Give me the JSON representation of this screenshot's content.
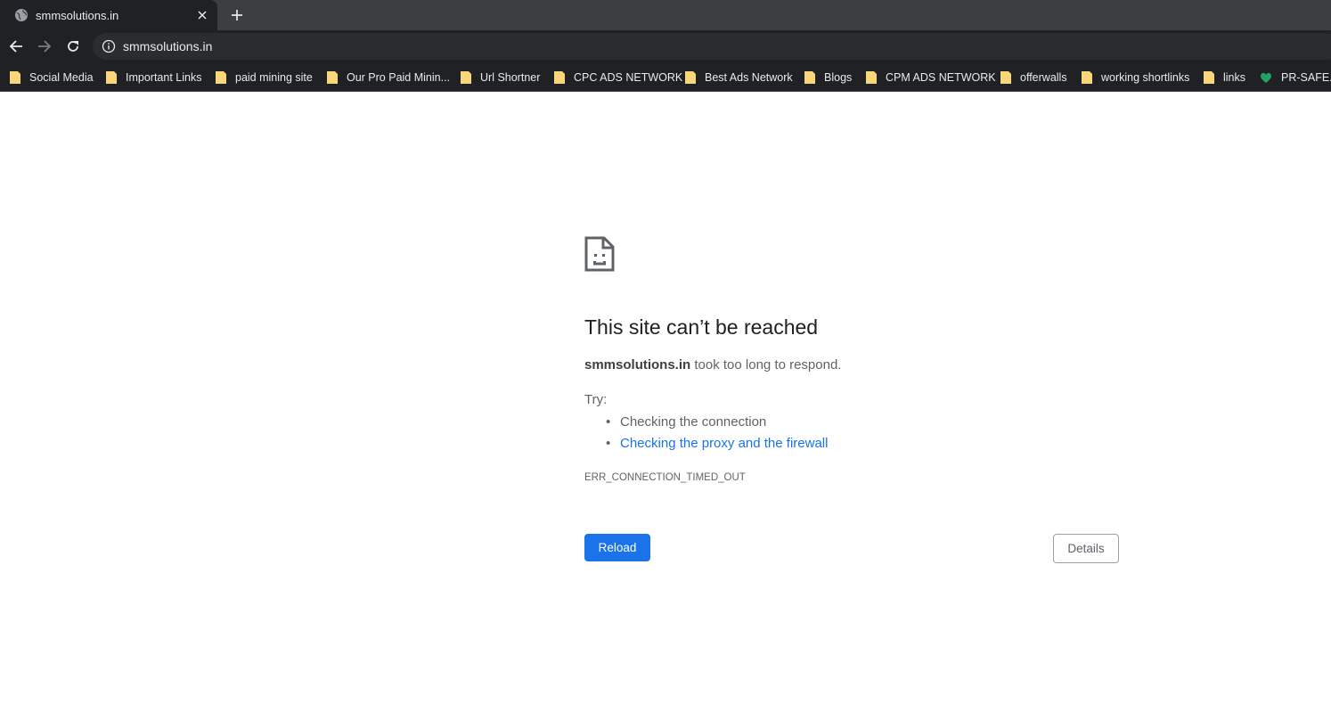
{
  "tab": {
    "title": "smmsolutions.in",
    "favicon": "globe-icon",
    "close_icon": "close-icon",
    "new_tab_icon": "plus-icon"
  },
  "toolbar": {
    "back_icon": "arrow-back-icon",
    "forward_icon": "arrow-forward-icon",
    "reload_icon": "reload-icon",
    "info_icon": "info-icon",
    "url": "smmsolutions.in"
  },
  "bookmarks": [
    {
      "label": "Social Media",
      "icon": "folder-icon"
    },
    {
      "label": "Important Links",
      "icon": "folder-icon"
    },
    {
      "label": "paid mining site",
      "icon": "folder-icon"
    },
    {
      "label": "Our Pro Paid Minin...",
      "icon": "folder-icon"
    },
    {
      "label": "Url Shortner",
      "icon": "folder-icon"
    },
    {
      "label": "CPC ADS NETWORK",
      "icon": "folder-icon"
    },
    {
      "label": "Best Ads Network",
      "icon": "folder-icon"
    },
    {
      "label": "Blogs",
      "icon": "folder-icon"
    },
    {
      "label": "CPM ADS NETWORK",
      "icon": "folder-icon"
    },
    {
      "label": "offerwalls",
      "icon": "folder-icon"
    },
    {
      "label": "working shortlinks",
      "icon": "folder-icon"
    },
    {
      "label": "links",
      "icon": "folder-icon"
    },
    {
      "label": "PR-SAFE.C",
      "icon": "site-favicon-icon"
    }
  ],
  "error": {
    "icon": "sad-page-icon",
    "heading": "This site can’t be reached",
    "host": "smmsolutions.in",
    "message": " took too long to respond.",
    "try_label": "Try:",
    "suggestions": [
      {
        "text": "Checking the connection",
        "link": false
      },
      {
        "text": "Checking the proxy and the firewall",
        "link": true
      }
    ],
    "code": "ERR_CONNECTION_TIMED_OUT",
    "reload_label": "Reload",
    "details_label": "Details"
  },
  "colors": {
    "frame": "#3c3e41",
    "toolbar": "#202124",
    "omnibox": "#2b2c2f",
    "folder": "#f9d67a",
    "accent": "#1a73e8",
    "text": "#202124",
    "secondary_text": "#5f6368"
  }
}
